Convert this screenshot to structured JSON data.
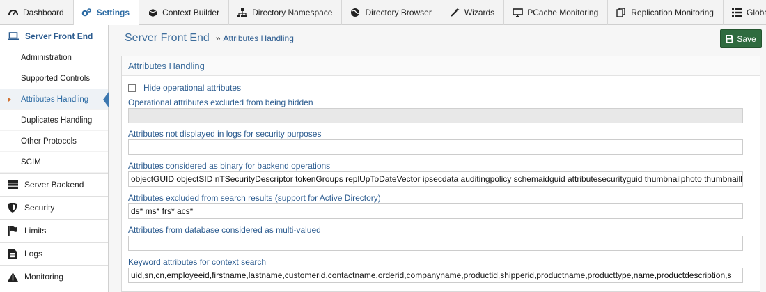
{
  "top_tabs": [
    {
      "label": "Dashboard",
      "icon": "dashboard-icon"
    },
    {
      "label": "Settings",
      "icon": "gears-icon",
      "active": true
    },
    {
      "label": "Context Builder",
      "icon": "cube-icon"
    },
    {
      "label": "Directory Namespace",
      "icon": "sitemap-icon"
    },
    {
      "label": "Directory Browser",
      "icon": "globe-icon"
    },
    {
      "label": "Wizards",
      "icon": "magic-wand-icon"
    },
    {
      "label": "PCache Monitoring",
      "icon": "monitor-icon"
    },
    {
      "label": "Replication Monitoring",
      "icon": "copy-icon"
    },
    {
      "label": "Global Sync",
      "icon": "list-icon"
    }
  ],
  "sidebar": {
    "section_title": "Server Front End",
    "section_icon": "laptop-icon",
    "sub_items": [
      {
        "label": "Administration"
      },
      {
        "label": "Supported Controls"
      },
      {
        "label": "Attributes Handling",
        "active": true
      },
      {
        "label": "Duplicates Handling"
      },
      {
        "label": "Other Protocols"
      },
      {
        "label": "SCIM"
      }
    ],
    "main_items": [
      {
        "label": "Server Backend",
        "icon": "server-icon"
      },
      {
        "label": "Security",
        "icon": "shield-icon"
      },
      {
        "label": "Limits",
        "icon": "flag-icon"
      },
      {
        "label": "Logs",
        "icon": "file-icon"
      },
      {
        "label": "Monitoring",
        "icon": "warning-icon"
      }
    ]
  },
  "breadcrumb": {
    "main": "Server Front End",
    "separator": "»",
    "sub": "Attributes Handling"
  },
  "save_button": {
    "label": "Save",
    "icon": "save-icon"
  },
  "panel": {
    "title": "Attributes Handling",
    "hide_operational": {
      "label": "Hide operational attributes",
      "checked": false
    },
    "fields": [
      {
        "label": "Operational attributes excluded from being hidden",
        "value": "",
        "disabled": true
      },
      {
        "label": "Attributes not displayed in logs for security purposes",
        "value": ""
      },
      {
        "label": "Attributes considered as binary for backend operations",
        "value": "objectGUID objectSID nTSecurityDescriptor tokenGroups replUpToDateVector ipsecdata auditingpolicy schemaidguid attributesecurityguid thumbnailphoto thumbnaillogo"
      },
      {
        "label": "Attributes excluded from search results (support for Active Directory)",
        "value": "ds* ms* frs* acs*"
      },
      {
        "label": "Attributes from database considered as multi-valued",
        "value": ""
      },
      {
        "label": "Keyword attributes for context search",
        "value": "uid,sn,cn,employeeid,firstname,lastname,customerid,contactname,orderid,companyname,productid,shipperid,productname,producttype,name,productdescription,s"
      }
    ]
  },
  "colors": {
    "accent": "#2b6aa3",
    "label": "#2b5b8f",
    "save_bg": "#2f6b3f"
  }
}
